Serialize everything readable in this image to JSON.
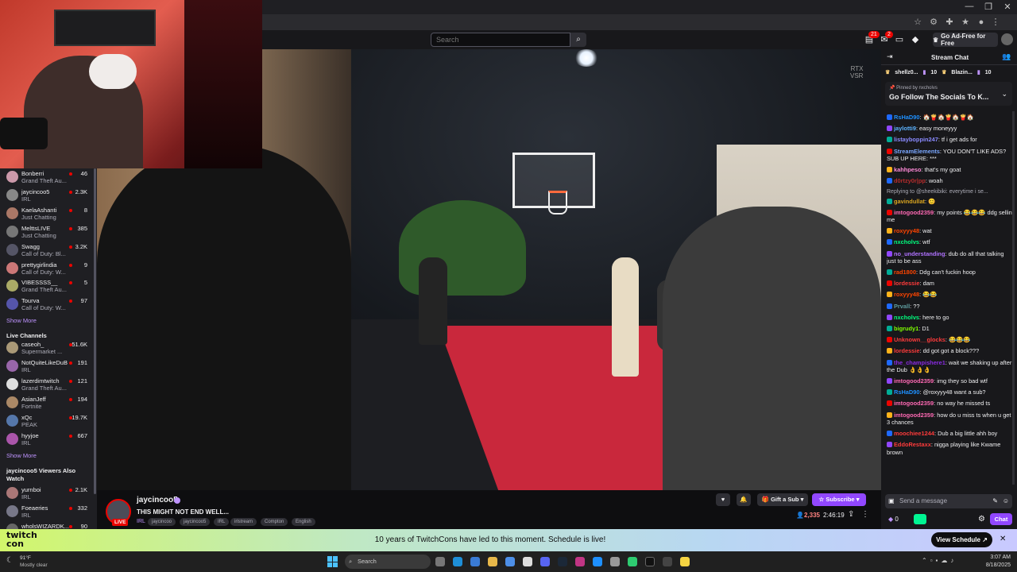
{
  "browser": {
    "controls": [
      "—",
      "❐",
      "✕"
    ]
  },
  "topnav": {
    "search_placeholder": "Search",
    "notification_badge": "21",
    "inbox_badge": "2",
    "adfree_label": "Go Ad-Free for Free"
  },
  "sidebar": {
    "followed": [
      {
        "name": "Bonberri",
        "game": "Grand Theft Au...",
        "viewers": "46",
        "color": "#c9a"
      },
      {
        "name": "jaycincoo5",
        "game": "IRL",
        "viewers": "2.3K",
        "color": "#888"
      },
      {
        "name": "KaelaAshanti",
        "game": "Just Chatting",
        "viewers": "8",
        "color": "#a76"
      },
      {
        "name": "MelttsLIVE",
        "game": "Just Chatting",
        "viewers": "385",
        "color": "#777"
      },
      {
        "name": "Swagg",
        "game": "Call of Duty: Bl...",
        "viewers": "3.2K",
        "color": "#556"
      },
      {
        "name": "prettygirlindia",
        "game": "Call of Duty: W...",
        "viewers": "9",
        "color": "#c77"
      },
      {
        "name": "VIBESSSS__",
        "game": "Grand Theft Au...",
        "viewers": "5",
        "color": "#aa6"
      },
      {
        "name": "Tourva",
        "game": "Call of Duty: W...",
        "viewers": "97",
        "color": "#55a"
      }
    ],
    "show_more_1": "Show More",
    "live_channels_heading": "Live Channels",
    "live": [
      {
        "name": "caseoh_",
        "game": "Supermarket ...",
        "viewers": "51.6K",
        "color": "#a97"
      },
      {
        "name": "NotQuiteLikeDuB",
        "game": "IRL",
        "viewers": "191",
        "color": "#96a"
      },
      {
        "name": "lazerdimtwitch",
        "game": "Grand Theft Au...",
        "viewers": "121",
        "color": "#ddd"
      },
      {
        "name": "AsianJeff",
        "game": "Fortnite",
        "viewers": "194",
        "color": "#a86"
      },
      {
        "name": "xQc",
        "game": "PEAK",
        "viewers": "19.7K",
        "color": "#57a"
      },
      {
        "name": "hyyjoe",
        "game": "IRL",
        "viewers": "667",
        "color": "#a5a"
      }
    ],
    "show_more_2": "Show More",
    "also_watch_heading": "jaycincoo5 Viewers Also Watch",
    "also": [
      {
        "name": "yurnboi",
        "game": "IRL",
        "viewers": "2.1K",
        "color": "#a77"
      },
      {
        "name": "Foeaeries",
        "game": "IRL",
        "viewers": "332",
        "color": "#778"
      },
      {
        "name": "wholsWIZARDK...",
        "game": "",
        "viewers": "90",
        "color": "#666"
      }
    ]
  },
  "stream": {
    "streamer": "jaycincoo5",
    "live_label": "LIVE",
    "title": "THIS MIGHT NOT END WELL...",
    "category": "IRL",
    "tags": [
      "jaycincoo",
      "jaycincoo5",
      "IRL",
      "irlstream",
      "Compton",
      "English"
    ],
    "gift_label": "Gift a Sub",
    "subscribe_label": "Subscribe",
    "viewers": "2,335",
    "uptime": "2:46:19",
    "video_watermark_1": "RTX",
    "video_watermark_2": "VSR"
  },
  "chat": {
    "title": "Stream Chat",
    "gift_leaders": [
      {
        "name": "shellz0...",
        "count": "10"
      },
      {
        "name": "Blazin...",
        "count": "10"
      }
    ],
    "pinned_by": "Pinned by nxcholvs",
    "pinned_text": "Go Follow The Socials To K...",
    "messages": [
      {
        "user": "RsHaD90",
        "color": "#1e90ff",
        "text": "🏠🍟🏠🍟🏠🍟🏠"
      },
      {
        "user": "jaylotti9",
        "color": "#5cb3ff",
        "text": "easy moneyyy"
      },
      {
        "user": "listayboppin247",
        "color": "#8a8aff",
        "text": "tf i get ads for"
      },
      {
        "user": "StreamElements",
        "color": "#7aa7ff",
        "text": "YOU DON'T LIKE ADS? SUB UP HERE: ***"
      },
      {
        "user": "kahhpeso",
        "color": "#ff8ad8",
        "text": "that's my goat"
      },
      {
        "user": "d0rtzy0r|pp",
        "color": "#b62c2c",
        "text": "woah"
      },
      {
        "user": "",
        "color": "#adadb8",
        "text": "Replying to @sheekibiki: everytime i se...",
        "reply": true
      },
      {
        "user": "gavindullat",
        "color": "#daa520",
        "text": "😊"
      },
      {
        "user": "imtogood2359",
        "color": "#ff69b4",
        "text": "my points 😂😂😂 ddg sellin me"
      },
      {
        "user": "roxyyy48",
        "color": "#ff4500",
        "text": "wat"
      },
      {
        "user": "nxcholvs",
        "color": "#00ff7f",
        "text": "wtf"
      },
      {
        "user": "no_understanding",
        "color": "#b072ff",
        "text": "dub do all that talking just to be ass"
      },
      {
        "user": "rad1800",
        "color": "#ff4500",
        "text": "Ddg can't fuckin hoop"
      },
      {
        "user": "lordessie",
        "color": "#ff3b3b",
        "text": "dam"
      },
      {
        "user": "roxyyy48",
        "color": "#ff4500",
        "text": "😂😂"
      },
      {
        "user": "Prvall",
        "color": "#5f9ea0",
        "text": "??"
      },
      {
        "user": "nxcholvs",
        "color": "#00ff7f",
        "text": "here to go"
      },
      {
        "user": "bigrudy1",
        "color": "#7fff00",
        "text": "D1"
      },
      {
        "user": "Unknown__glocks",
        "color": "#ff3b3b",
        "text": "😂😂😂"
      },
      {
        "user": "lordessie",
        "color": "#ff3b3b",
        "text": "dd got got a block???"
      },
      {
        "user": "the_champishere1",
        "color": "#8a2be2",
        "text": "wait we shaking up after the Dub 👌👌👌"
      },
      {
        "user": "imtogood2359",
        "color": "#ff69b4",
        "text": "img they so bad wtf"
      },
      {
        "user": "RsHaD90",
        "color": "#1e90ff",
        "text": "@roxyyy48 want a sub?"
      },
      {
        "user": "imtogood2359",
        "color": "#ff69b4",
        "text": "no way he missed ts"
      },
      {
        "user": "imtogood2359",
        "color": "#ff69b4",
        "text": "how do u miss ts when u get 3 chances"
      },
      {
        "user": "moochiee1244",
        "color": "#ff3b3b",
        "text": "Dub a big little ahh boy"
      },
      {
        "user": "EddoRestaxx",
        "color": "#ff3b3b",
        "text": "nigga playing like Kwame brown"
      }
    ],
    "input_placeholder": "Send a message",
    "points": "0",
    "chat_button": "Chat"
  },
  "banner": {
    "logo_line1": "twitch",
    "logo_line2": "con",
    "text": "10 years of TwitchCons have led to this moment. Schedule is live!",
    "button": "View Schedule ↗",
    "close": "✕"
  },
  "taskbar": {
    "weather_temp": "91°F",
    "weather_desc": "Mostly clear",
    "search_label": "Search",
    "time": "3:07 AM",
    "date": "8/18/2025"
  }
}
